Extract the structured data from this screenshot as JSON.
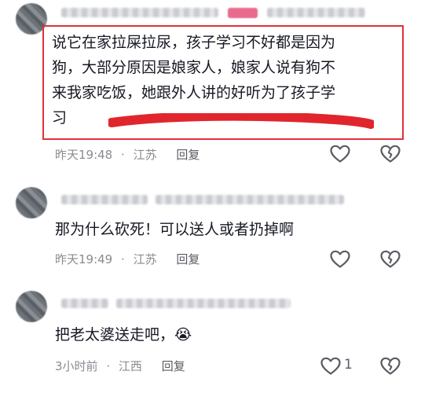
{
  "comments": [
    {
      "text_lines": [
        "说它在家拉屎拉尿，孩子学习不好都是因为",
        "狗，大部分原因是娘家人，娘家人说有狗不",
        "来我家吃饭，她跟外人讲的好听为了孩子学",
        "习"
      ],
      "time": "昨天19:48",
      "location": "江苏",
      "reply_label": "回复",
      "like_count": ""
    },
    {
      "text_lines": [
        "那为什么砍死！可以送人或者扔掉啊"
      ],
      "time": "昨天19:49",
      "location": "江苏",
      "reply_label": "回复",
      "like_count": ""
    },
    {
      "text_lines": [
        "把老太婆送走吧，😭"
      ],
      "time": "3小时前",
      "location": "江西",
      "reply_label": "回复",
      "like_count": "1"
    }
  ],
  "separator": "·",
  "colors": {
    "highlight_border": "#e03238",
    "meta_text": "#8a8b91",
    "body_text": "#161823"
  },
  "icons": [
    "heart-outline-icon",
    "broken-heart-icon",
    "crying-face-emoji"
  ]
}
